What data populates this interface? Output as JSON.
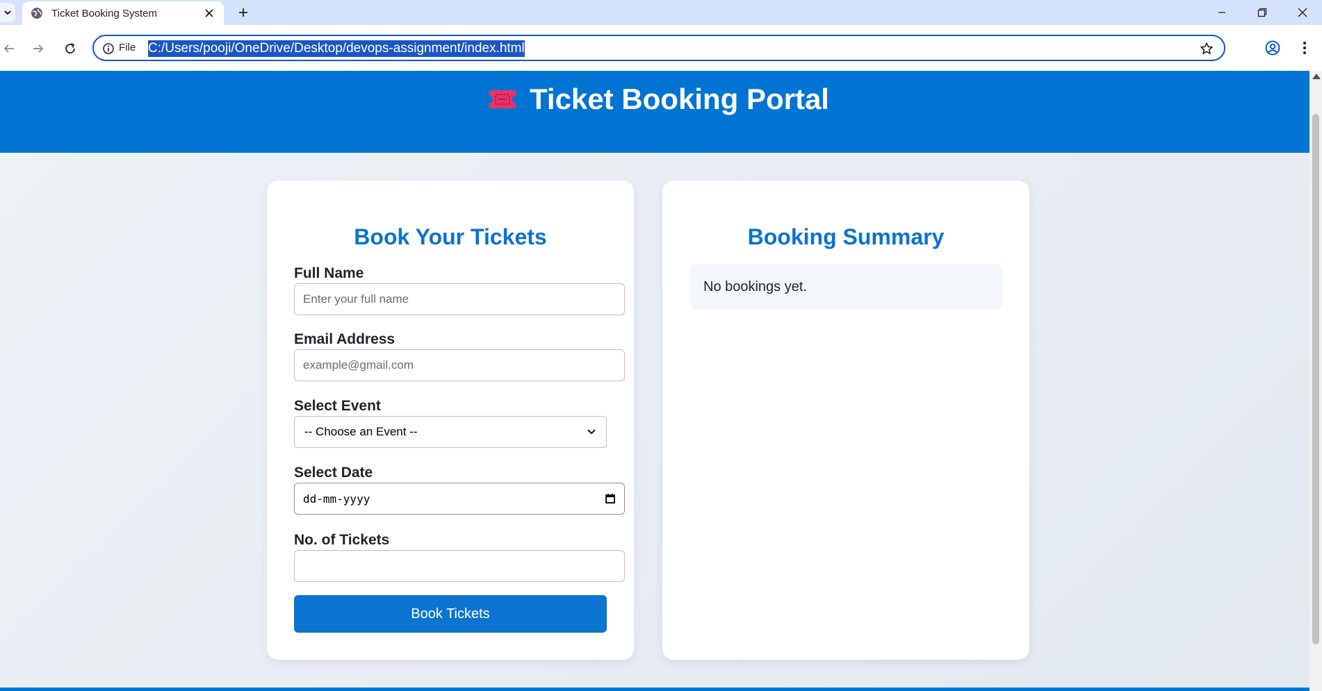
{
  "browser": {
    "tab_title": "Ticket Booking System",
    "address_scheme": "File",
    "address_url": "C:/Users/pooji/OneDrive/Desktop/devops-assignment/index.html"
  },
  "header": {
    "icon": "ticket-icon",
    "title": "Ticket Booking Portal"
  },
  "booking_form": {
    "heading": "Book Your Tickets",
    "full_name": {
      "label": "Full Name",
      "placeholder": "Enter your full name",
      "value": ""
    },
    "email": {
      "label": "Email Address",
      "placeholder": "example@gmail.com",
      "value": ""
    },
    "event": {
      "label": "Select Event",
      "selected": "-- Choose an Event --"
    },
    "date": {
      "label": "Select Date",
      "value": "dd-mm-yyyy"
    },
    "tickets": {
      "label": "No. of Tickets",
      "value": ""
    },
    "submit_label": "Book Tickets"
  },
  "summary": {
    "heading": "Booking Summary",
    "empty_text": "No bookings yet."
  },
  "colors": {
    "brand_blue": "#0074d2",
    "heading_blue": "#0a73cf",
    "ticket_pink": "#e8326a"
  }
}
